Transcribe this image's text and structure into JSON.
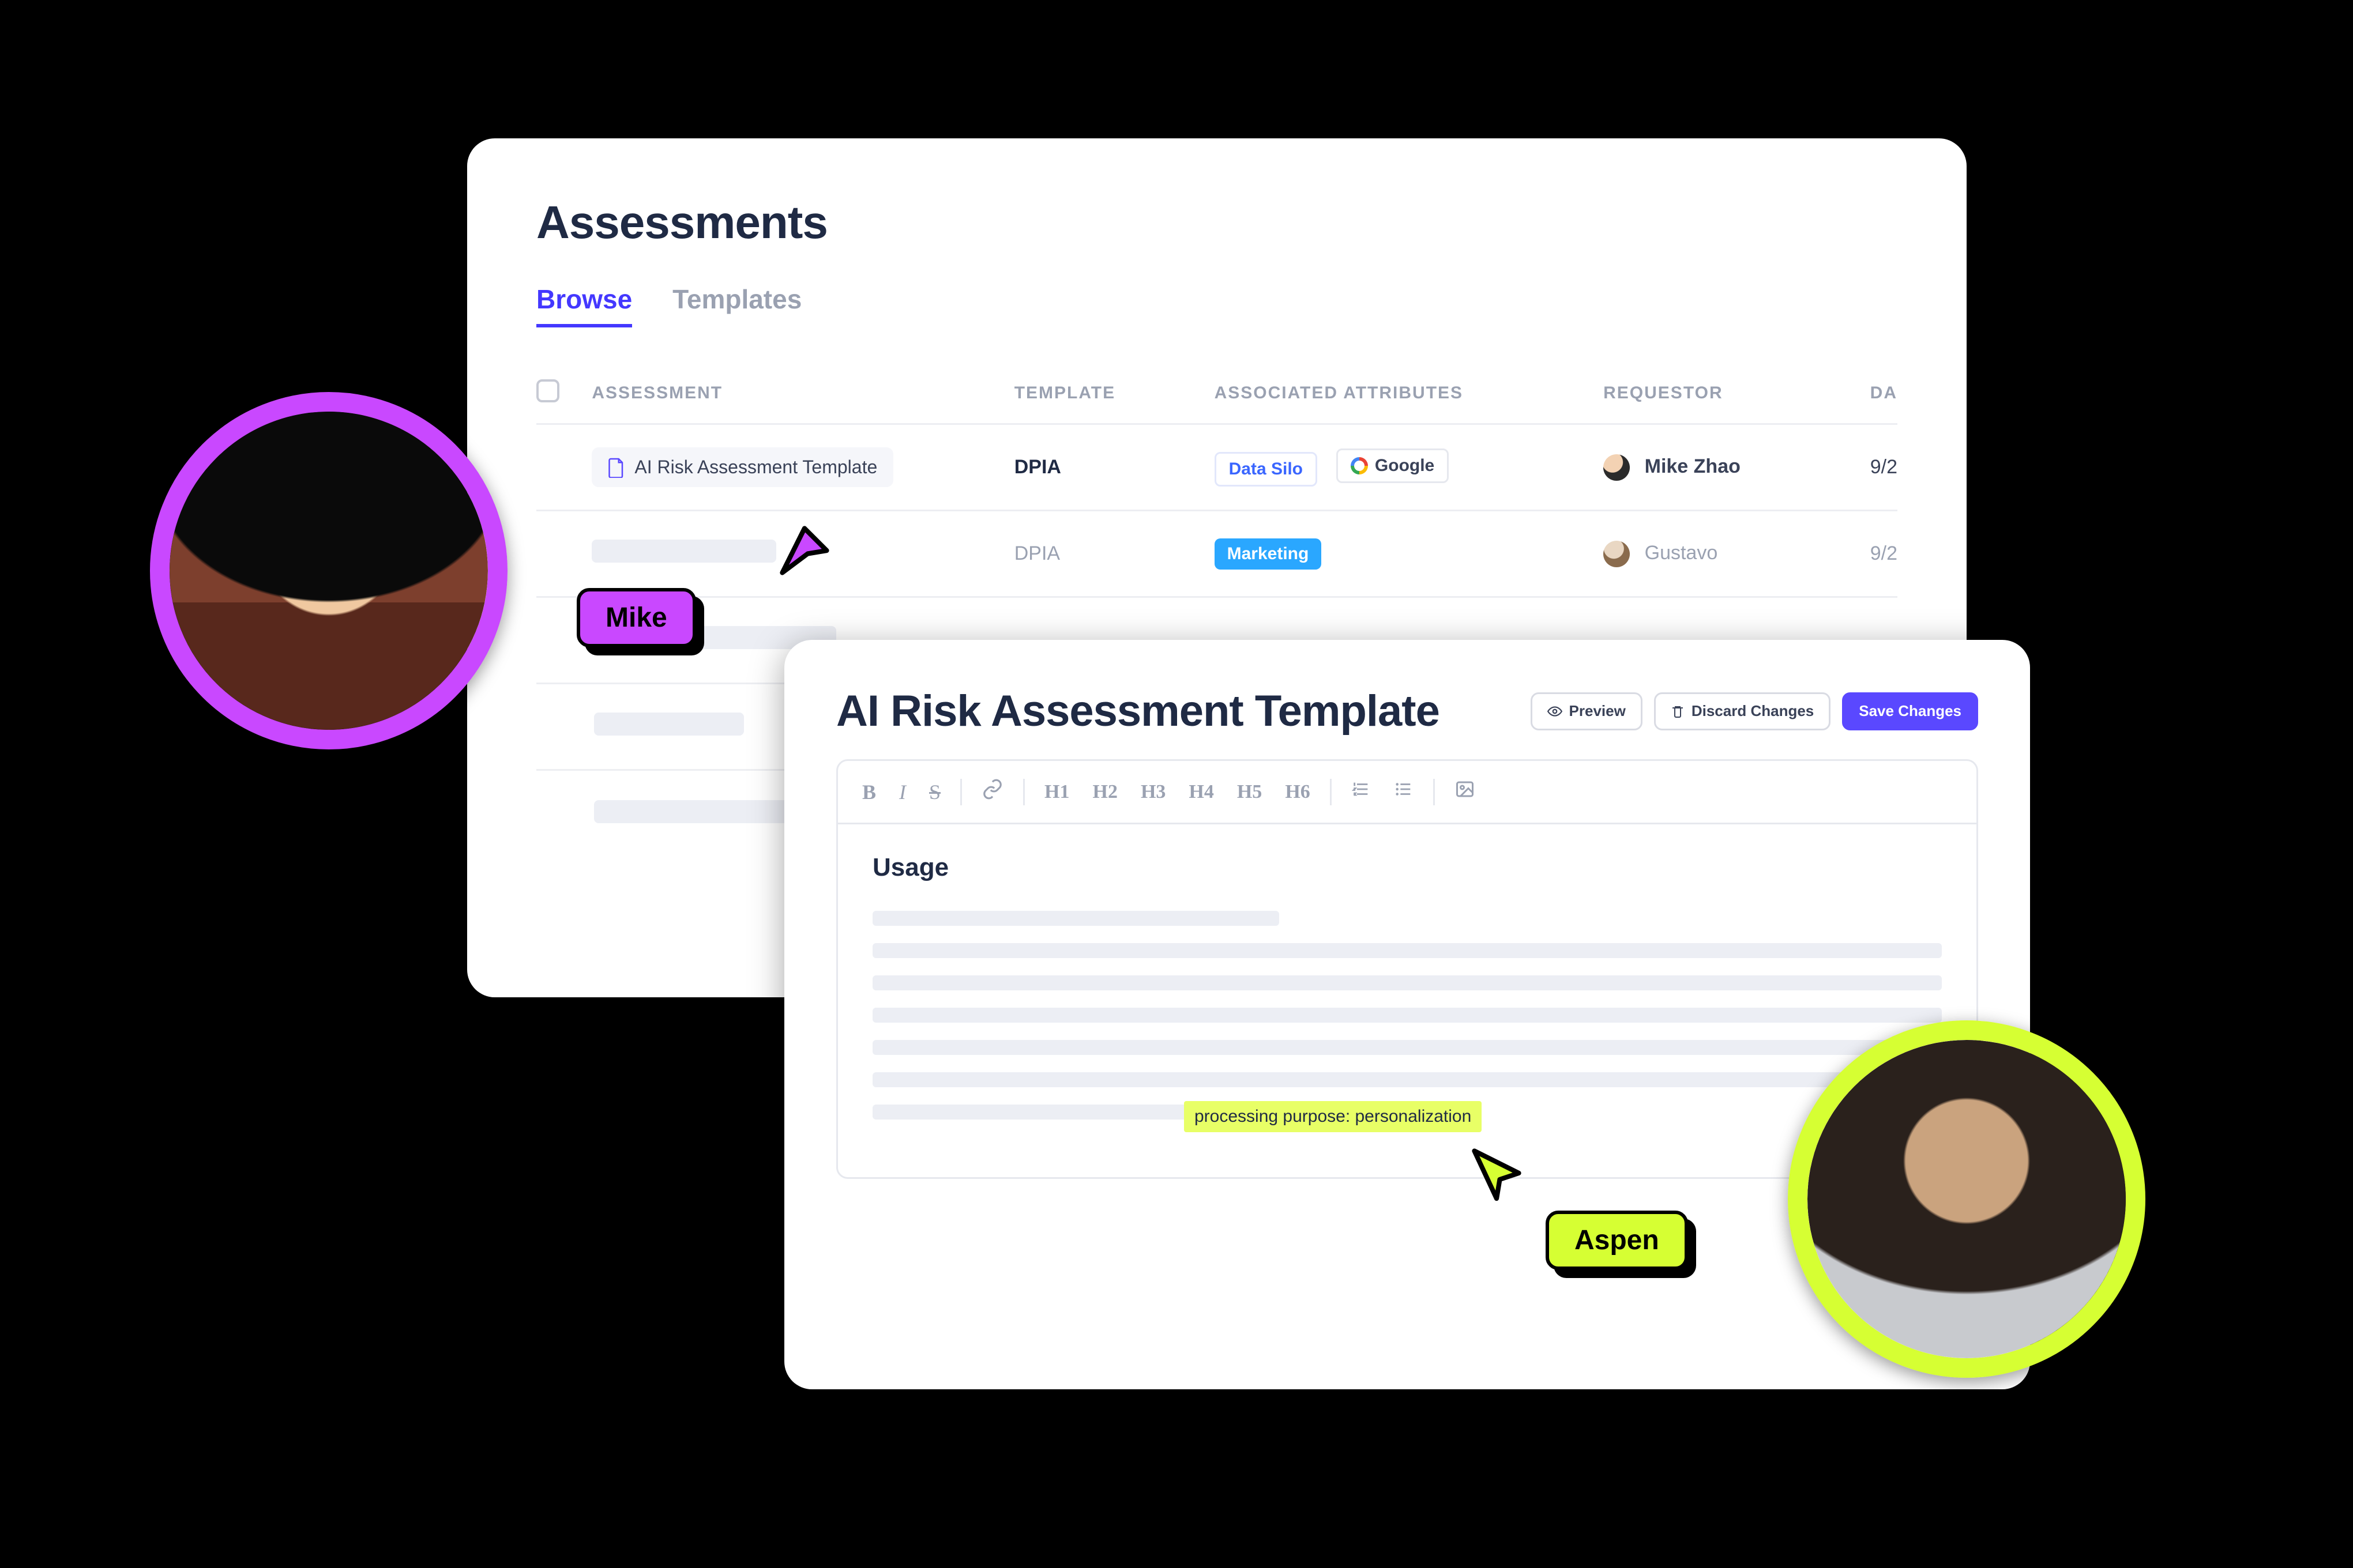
{
  "back": {
    "title": "Assessments",
    "tabs": [
      {
        "label": "Browse",
        "active": true
      },
      {
        "label": "Templates",
        "active": false
      }
    ],
    "columns": {
      "assessment": "ASSESSMENT",
      "template": "TEMPLATE",
      "attributes": "ASSOCIATED ATTRIBUTES",
      "requestor": "REQUESTOR",
      "date": "DA"
    },
    "rows": [
      {
        "assessment": "AI Risk Assessment Template",
        "template": "DPIA",
        "attributes": {
          "data_silo": "Data Silo",
          "google": "Google"
        },
        "requestor": "Mike Zhao",
        "date": "9/2"
      },
      {
        "assessment": null,
        "template": "DPIA",
        "attributes": {
          "marketing": "Marketing"
        },
        "requestor": "Gustavo",
        "date": "9/2"
      }
    ]
  },
  "front": {
    "title": "AI Risk Assessment Template",
    "actions": {
      "preview": "Preview",
      "discard": "Discard Changes",
      "save": "Save Changes"
    },
    "toolbar": {
      "bold": "B",
      "italic": "I",
      "strike": "S",
      "link": "🔗",
      "h1": "H1",
      "h2": "H2",
      "h3": "H3",
      "h4": "H4",
      "h5": "H5",
      "h6": "H6",
      "ol": "ol",
      "ul": "ul",
      "image": "img"
    },
    "section_heading": "Usage",
    "highlight": "processing purpose: personalization"
  },
  "collab": {
    "mike": {
      "name": "Mike",
      "color": "#c948ff"
    },
    "aspen": {
      "name": "Aspen",
      "color": "#d6ff33"
    }
  }
}
